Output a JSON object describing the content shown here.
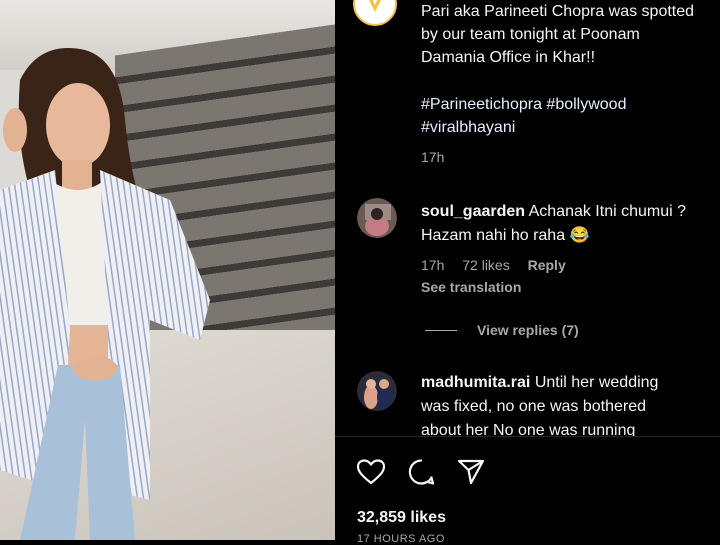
{
  "post": {
    "caption_lines": [
      "Pari aka Parineeti Chopra was spotted",
      "by our team tonight at Poonam",
      "Damania Office in Khar!!"
    ],
    "hashtag_lines": [
      "#Parineetichopra #bollywood",
      "#viralbhayani"
    ],
    "time": "17h"
  },
  "comments": [
    {
      "username": "soul_gaarden",
      "text_line1": "Achanak Itni chumui ?",
      "text_line2": "Hazam nahi ho raha 😂",
      "time": "17h",
      "likes": "72 likes",
      "reply": "Reply",
      "see_translation": "See translation",
      "view_replies": "View replies (7)"
    },
    {
      "username": "madhumita.rai",
      "text_line1": "Until her wedding",
      "text_line2": "was fixed, no one was bothered",
      "text_line3": "about her No one was running"
    }
  ],
  "footer": {
    "likes": "32,859 likes",
    "ago": "17 HOURS AGO"
  },
  "icons": [
    "logo-icon",
    "heart-icon",
    "comment-icon",
    "share-icon"
  ],
  "colors": {
    "background": "#000000",
    "text": "#f5f5f5",
    "muted": "#a8a8a8",
    "hashtag": "#e0f1ff",
    "logo_ring": "#f3c341"
  }
}
